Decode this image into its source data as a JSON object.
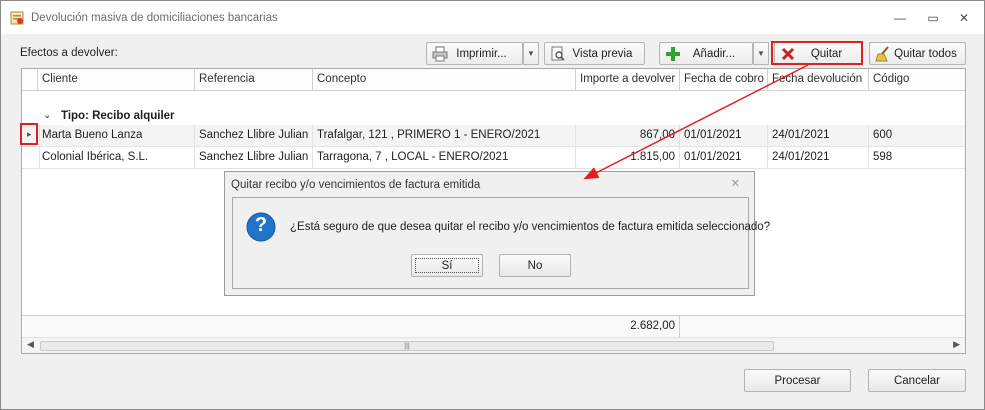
{
  "window": {
    "title": "Devolución masiva de domiciliaciones bancarias",
    "controls": {
      "minimize": "—",
      "restore": "▭",
      "close": "✕"
    }
  },
  "toolbar": {
    "label": "Efectos a devolver:",
    "print_label": "Imprimir...",
    "preview_label": "Vista previa",
    "add_label": "Añadir...",
    "remove_label": "Quitar",
    "remove_all_label": "Quitar todos",
    "dropdown_glyph": "▼"
  },
  "grid": {
    "columns": [
      "Cliente",
      "Referencia",
      "Concepto",
      "Importe a devolver",
      "Fecha de cobro",
      "Fecha devolución",
      "Código"
    ],
    "group": {
      "chevron": "⌄",
      "label": "Tipo: Recibo alquiler"
    },
    "rows": [
      {
        "cliente": "Marta Bueno Lanza",
        "referencia": "Sanchez Llibre Julian ...",
        "concepto": "Trafalgar, 121 , PRIMERO 1 - ENERO/2021",
        "importe": "867,00",
        "fecha_cobro": "01/01/2021",
        "fecha_devolucion": "24/01/2021",
        "codigo": "600"
      },
      {
        "cliente": "Colonial Ibérica, S.L.",
        "referencia": "Sanchez Llibre Julian ...",
        "concepto": "Tarragona, 7 , LOCAL - ENERO/2021",
        "importe": "1.815,00",
        "fecha_cobro": "01/01/2021",
        "fecha_devolucion": "24/01/2021",
        "codigo": "598"
      }
    ],
    "current_row_marker": "▸",
    "total": "2.682,00",
    "scroll": {
      "left": "◀",
      "right": "▶",
      "grip": "|||"
    }
  },
  "dialog": {
    "title": "Quitar recibo y/o vencimientos de factura emitida",
    "close": "✕",
    "icon_glyph": "?",
    "message": "¿Está seguro de que desea quitar el recibo y/o vencimientos de factura emitida seleccionado?",
    "yes_label": "Sí",
    "no_label": "No"
  },
  "footer": {
    "process_label": "Procesar",
    "cancel_label": "Cancelar"
  },
  "colors": {
    "highlight_red": "#e02020",
    "question_blue": "#1f73c9",
    "add_green": "#2fa32f"
  }
}
